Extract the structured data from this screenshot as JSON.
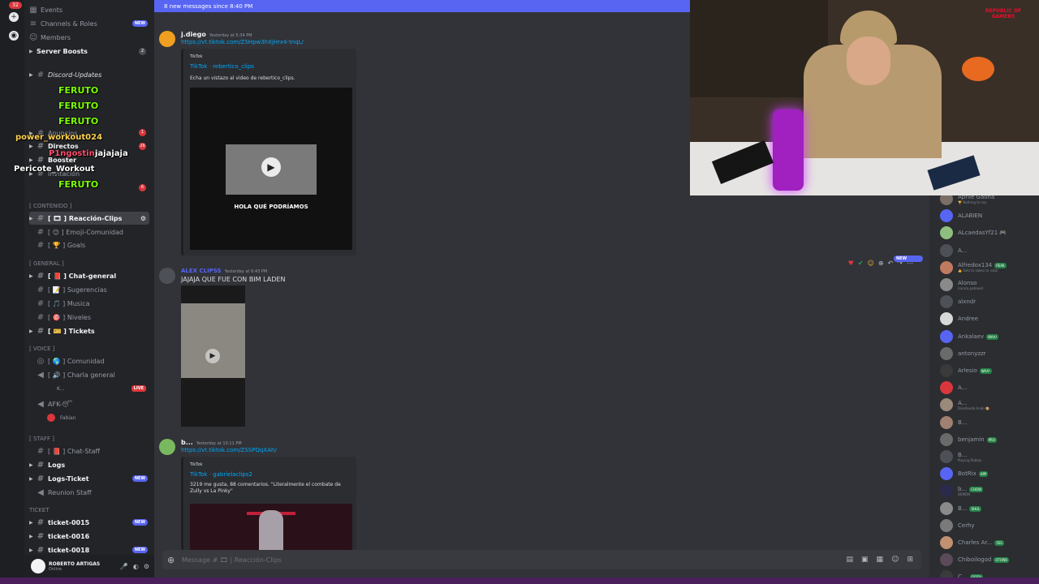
{
  "server_menu": [
    "Events",
    "Channels & Roles",
    "Members",
    "Server Boosts"
  ],
  "badges": {
    "new": "NEW",
    "live": "LIVE",
    "boosts": "2",
    "red1": "1",
    "red26": "26",
    "red6": "6",
    "notif": "32"
  },
  "channels": {
    "discord_updates": "Discord-Updates",
    "anuncios": "Anuncios",
    "directos": "Directos",
    "booster": "Booster",
    "invitacion": "Invitación",
    "cat_contenido": "[ CONTENIDO ]",
    "reaccion_clips": "[ 🎞 ] Reacción-Clips",
    "emoji_comunidad": "[ 😊 ] Emoji-Comunidad",
    "goals": "[ 🏆 ] Goals",
    "cat_general": "[ GENERAL ]",
    "chat_general": "[ 📕 ] Chat-general",
    "sugerencias": "[ 📝 ] Sugerencias",
    "musica": "[ 🎵 ] Musica",
    "niveles": "[ 🎯 ] Niveles",
    "tickets": "[ 🎫 ] Tickets",
    "cat_voice": "[ VOICE ]",
    "comunidad": "[ 🌎 ] Comunidad",
    "charla_general": "[ 🔊 ] Charla general",
    "voice_user_k": "K...",
    "afk": "AFK-😴",
    "voice_user_fabian": "Fabian",
    "cat_staff": "[ STAFF ]",
    "chat_staff": "[ 📕 ] Chat-Staff",
    "logs": "Logs",
    "logs_ticket": "Logs-Ticket",
    "reunion_staff": "Reunion Staff",
    "cat_ticket": "TICKET",
    "ticket_0015": "ticket-0015",
    "ticket_0016": "ticket-0016",
    "ticket_0018": "ticket-0018"
  },
  "overlay_names": [
    "FERUTO",
    "FERUTO",
    "FERUTO",
    "power_workout024",
    "P1ngostini",
    "jajajaja",
    "Pericote_Workout",
    "FERUTO"
  ],
  "user": {
    "name": "ROBERTO ARTIGAS",
    "status": "Online"
  },
  "banner": "8 new messages since 8:40 PM",
  "messages": [
    {
      "author": "j.diego",
      "time": "Yesterday at 5:34 PM",
      "link": "https://vt.tiktok.com/ZSHpw3hXjHrx4-tnqL/",
      "embed_provider": "TikTok",
      "embed_title": "TikTok · rebertico_clips",
      "embed_desc": "Echa un vistazo al video de rebertico_clips.",
      "video_caption": "HOLA QUÉ PODRÍAMOS"
    },
    {
      "author": "ALEX CLIPSS",
      "time": "Yesterday at 6:43 PM",
      "text": "JAJAJA QUE FUE CON BIM LADEN"
    },
    {
      "author": "b...",
      "time": "Yesterday at 10:11 PM",
      "link": "https://vt.tiktok.com/ZSSPQqXAh/",
      "embed_provider": "TikTok",
      "embed_title": "TikTok · gabrielaclips2",
      "embed_desc": "3219 me gusta, 88 comentarios. \"Literalmente el combate de Zully vs La Pinky\""
    }
  ],
  "reaction_new": "NEW",
  "composer_placeholder": "Message # 🎞 | Reacción-Clips",
  "cam_brand": "REPUBLIC OF GAMERS",
  "members": [
    {
      "name": "Aprile Gaona",
      "sub": "🏆 Nothing to say",
      "color": "#949ba4"
    },
    {
      "name": "ALABIEN",
      "color": "#949ba4"
    },
    {
      "name": "ALcaedasYf21 🎮",
      "color": "#949ba4"
    },
    {
      "name": "A...",
      "color": "#949ba4"
    },
    {
      "name": "Alfredox134",
      "tag": "PEAK",
      "sub": "👍 Solo tú sabes tu valor",
      "color": "#949ba4"
    },
    {
      "name": "Alonso",
      "sub": "ironica pateaxd",
      "color": "#949ba4"
    },
    {
      "name": "alxndr",
      "color": "#949ba4"
    },
    {
      "name": "Andree",
      "color": "#949ba4"
    },
    {
      "name": "Ankalaev",
      "tag": "WAA!",
      "color": "#949ba4"
    },
    {
      "name": "antonyzzr",
      "color": "#949ba4"
    },
    {
      "name": "Arlesio",
      "tag": "WAA!",
      "color": "#949ba4"
    },
    {
      "name": "A...",
      "color": "#949ba4"
    },
    {
      "name": "A...",
      "sub": "Diseñando Ando 🎨",
      "color": "#949ba4"
    },
    {
      "name": "B...",
      "color": "#949ba4"
    },
    {
      "name": "benjamin",
      "tag": "PRO",
      "color": "#949ba4"
    },
    {
      "name": "B...",
      "sub": "Playing Roblox",
      "color": "#949ba4"
    },
    {
      "name": "BotRix",
      "tag": "APP",
      "color": "#949ba4"
    },
    {
      "name": "b...",
      "tag": "CHOW",
      "sub": "DEMON",
      "color": "#949ba4"
    },
    {
      "name": "B...",
      "tag": "SHUL",
      "color": "#949ba4"
    },
    {
      "name": "Cerhy",
      "color": "#949ba4"
    },
    {
      "name": "Charles Ar...",
      "tag": "YES",
      "color": "#949ba4"
    },
    {
      "name": "Chiboilogod",
      "tag": "OTOÑO",
      "color": "#949ba4"
    },
    {
      "name": "C...",
      "tag": "GOZU",
      "color": "#949ba4"
    }
  ],
  "colors": {
    "accent": "#5865f2",
    "bg": "#313338",
    "sidebar": "#232428",
    "members": "#2b2d31",
    "link": "#00a8fc",
    "live": "#da373c"
  }
}
